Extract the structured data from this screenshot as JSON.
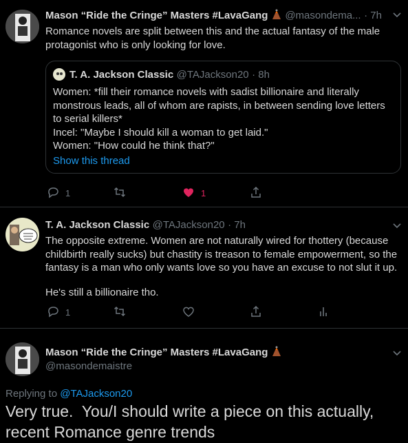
{
  "tweet1": {
    "author": "Mason “Ride the Cringe” Masters #LavaGang",
    "handle": "@masondema...",
    "time": "· 7h",
    "text": "Romance novels are split between this and the actual fantasy of the male protagonist who is only looking for love.",
    "quote": {
      "author": "T. A. Jackson Classic",
      "handle": "@TAJackson20",
      "time": "· 8h",
      "lines": [
        "Women: *fill their romance novels with sadist billionaire and literally",
        "monstrous leads, all of whom are rapists, in between sending love letters",
        "to serial killers*",
        "Incel: \"Maybe I should kill a woman to get laid.\"",
        "Women: \"How could he think that?\""
      ],
      "show_thread": "Show this thread"
    },
    "reply_count": "1",
    "like_count": "1"
  },
  "tweet2": {
    "author": "T. A. Jackson Classic",
    "handle": "@TAJackson20",
    "time": "· 7h",
    "lines": [
      "The opposite extreme. Women are not naturally wired for thottery (because",
      "childbirth really sucks) but chastity is treason to female empowerment, so the",
      "fantasy is a man who only wants love so you have an excuse to not slut it up."
    ],
    "line4": "He's still a billionaire tho.",
    "reply_count": "1"
  },
  "tweet3": {
    "author": "Mason “Ride the Cringe” Masters #LavaGang",
    "handle": "@masondemaistre",
    "replying_prefix": "Replying to",
    "replying_handle": "@TAJackson20",
    "text_line1": "Very true.  You/I should write a piece on this actually,",
    "text_line2": "recent Romance genre trends"
  },
  "colors": {
    "like": "#e0245e",
    "link": "#1d9bf0",
    "secondary": "#6e767d"
  },
  "icons": [
    "volcano-icon",
    "reply-icon",
    "retweet-icon",
    "heart-icon",
    "share-icon",
    "analytics-icon",
    "chevron-down-icon"
  ]
}
